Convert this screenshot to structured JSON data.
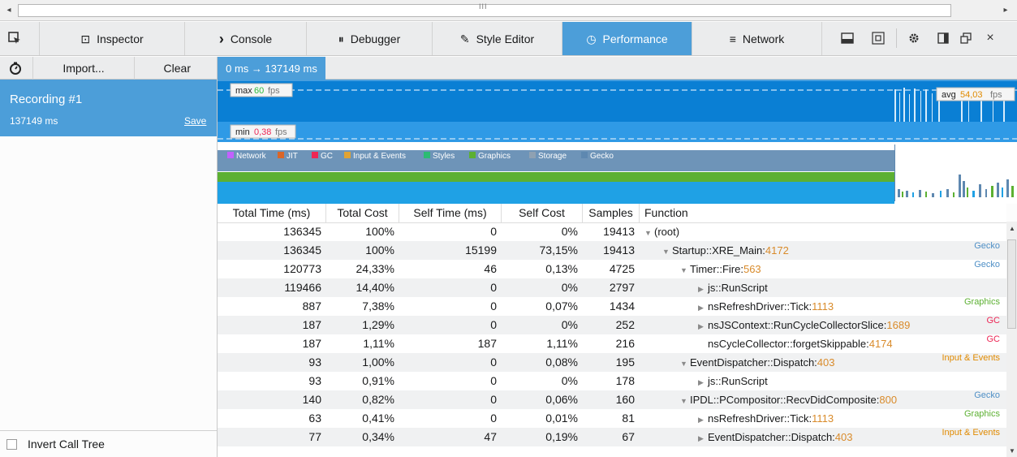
{
  "scrollbar": {
    "grip": "III",
    "left_arrow": "◂",
    "right_arrow": "▸"
  },
  "toolbar": {
    "tabs": [
      {
        "label": "Inspector",
        "icon": "inspector-icon",
        "glyph": "⊡"
      },
      {
        "label": "Console",
        "icon": "console-icon",
        "glyph": "›"
      },
      {
        "label": "Debugger",
        "icon": "debugger-icon",
        "glyph": "⏸"
      },
      {
        "label": "Style Editor",
        "icon": "style-editor-icon",
        "glyph": "✎"
      },
      {
        "label": "Performance",
        "icon": "performance-icon",
        "glyph": "◷"
      },
      {
        "label": "Network",
        "icon": "network-icon",
        "glyph": "≡"
      }
    ],
    "active_tab": "Performance"
  },
  "sidebar": {
    "import_label": "Import...",
    "clear_label": "Clear",
    "recording": {
      "name": "Recording #1",
      "duration": "137149 ms",
      "save_label": "Save"
    },
    "invert_label": "Invert Call Tree"
  },
  "overview": {
    "range_label": "0 ms → 137149 ms",
    "fps": {
      "max_label": "max",
      "max_value": "60",
      "min_label": "min",
      "min_value": "0,38",
      "avg_label": "avg",
      "avg_value": "54,03",
      "unit": "fps"
    },
    "legend": [
      {
        "name": "Network",
        "color": "#c261ff"
      },
      {
        "name": "JIT",
        "color": "#d96629"
      },
      {
        "name": "GC",
        "color": "#ed2655"
      },
      {
        "name": "Input & Events",
        "color": "#e0a334"
      },
      {
        "name": "Styles",
        "color": "#2cbb73"
      },
      {
        "name": "Graphics",
        "color": "#5cb032"
      },
      {
        "name": "Storage",
        "color": "#8fa1b2"
      },
      {
        "name": "Gecko",
        "color": "#5e88b0"
      }
    ]
  },
  "colors": {
    "accent": "#4c9ed9",
    "graph_bg": "#0072c6",
    "Gecko": "#4e8fc6",
    "Graphics": "#5cb032",
    "GC": "#ed2655",
    "Input & Events": "#e08a00",
    "line_number": "#d98b2b"
  },
  "calltree": {
    "headers": [
      "Total Time (ms)",
      "Total Cost",
      "Self Time (ms)",
      "Self Cost",
      "Samples",
      "Function"
    ],
    "rows": [
      {
        "total_time": "136345",
        "total_cost": "100%",
        "self_time": "0",
        "self_cost": "0%",
        "samples": "19413",
        "indent": 0,
        "twisty": "open",
        "fn": "(root)",
        "line": "",
        "category": ""
      },
      {
        "total_time": "136345",
        "total_cost": "100%",
        "self_time": "15199",
        "self_cost": "73,15%",
        "samples": "19413",
        "indent": 1,
        "twisty": "open",
        "fn": "Startup::XRE_Main:",
        "line": "4172",
        "category": "Gecko"
      },
      {
        "total_time": "120773",
        "total_cost": "24,33%",
        "self_time": "46",
        "self_cost": "0,13%",
        "samples": "4725",
        "indent": 2,
        "twisty": "open",
        "fn": "Timer::Fire:",
        "line": "563",
        "category": "Gecko"
      },
      {
        "total_time": "119466",
        "total_cost": "14,40%",
        "self_time": "0",
        "self_cost": "0%",
        "samples": "2797",
        "indent": 3,
        "twisty": "closed",
        "fn": "js::RunScript",
        "line": "",
        "category": ""
      },
      {
        "total_time": "887",
        "total_cost": "7,38%",
        "self_time": "0",
        "self_cost": "0,07%",
        "samples": "1434",
        "indent": 3,
        "twisty": "closed",
        "fn": "nsRefreshDriver::Tick:",
        "line": "1113",
        "category": "Graphics"
      },
      {
        "total_time": "187",
        "total_cost": "1,29%",
        "self_time": "0",
        "self_cost": "0%",
        "samples": "252",
        "indent": 3,
        "twisty": "closed",
        "fn": "nsJSContext::RunCycleCollectorSlice:",
        "line": "1689",
        "category": "GC"
      },
      {
        "total_time": "187",
        "total_cost": "1,11%",
        "self_time": "187",
        "self_cost": "1,11%",
        "samples": "216",
        "indent": 3,
        "twisty": "none",
        "fn": "nsCycleCollector::forgetSkippable:",
        "line": "4174",
        "category": "GC"
      },
      {
        "total_time": "93",
        "total_cost": "1,00%",
        "self_time": "0",
        "self_cost": "0,08%",
        "samples": "195",
        "indent": 2,
        "twisty": "open",
        "fn": "EventDispatcher::Dispatch:",
        "line": "403",
        "category": "Input & Events"
      },
      {
        "total_time": "93",
        "total_cost": "0,91%",
        "self_time": "0",
        "self_cost": "0%",
        "samples": "178",
        "indent": 3,
        "twisty": "closed",
        "fn": "js::RunScript",
        "line": "",
        "category": ""
      },
      {
        "total_time": "140",
        "total_cost": "0,82%",
        "self_time": "0",
        "self_cost": "0,06%",
        "samples": "160",
        "indent": 2,
        "twisty": "open",
        "fn": "IPDL::PCompositor::RecvDidComposite:",
        "line": "800",
        "category": "Gecko"
      },
      {
        "total_time": "63",
        "total_cost": "0,41%",
        "self_time": "0",
        "self_cost": "0,01%",
        "samples": "81",
        "indent": 3,
        "twisty": "closed",
        "fn": "nsRefreshDriver::Tick:",
        "line": "1113",
        "category": "Graphics"
      },
      {
        "total_time": "77",
        "total_cost": "0,34%",
        "self_time": "47",
        "self_cost": "0,19%",
        "samples": "67",
        "indent": 3,
        "twisty": "closed",
        "fn": "EventDispatcher::Dispatch:",
        "line": "403",
        "category": "Input & Events"
      }
    ]
  }
}
